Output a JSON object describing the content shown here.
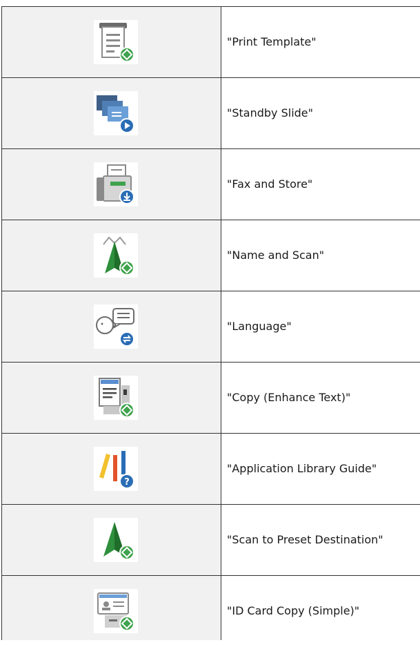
{
  "rows": [
    {
      "icon": "print-template-icon",
      "label": "\"Print Template\""
    },
    {
      "icon": "standby-slide-icon",
      "label": "\"Standby Slide\""
    },
    {
      "icon": "fax-and-store-icon",
      "label": "\"Fax and Store\""
    },
    {
      "icon": "name-and-scan-icon",
      "label": "\"Name and Scan\""
    },
    {
      "icon": "language-icon",
      "label": "\"Language\""
    },
    {
      "icon": "copy-enhance-text-icon",
      "label": "\"Copy (Enhance Text)\""
    },
    {
      "icon": "application-library-guide-icon",
      "label": "\"Application Library Guide\""
    },
    {
      "icon": "scan-to-preset-destination-icon",
      "label": "\"Scan to Preset Destination\""
    },
    {
      "icon": "id-card-copy-icon",
      "label": "\"ID Card Copy (Simple)\""
    }
  ],
  "colors": {
    "green_badge": "#3fa34d",
    "blue_badge": "#2a6db5",
    "cell_bg": "#f1f1f1",
    "border": "#333333"
  }
}
